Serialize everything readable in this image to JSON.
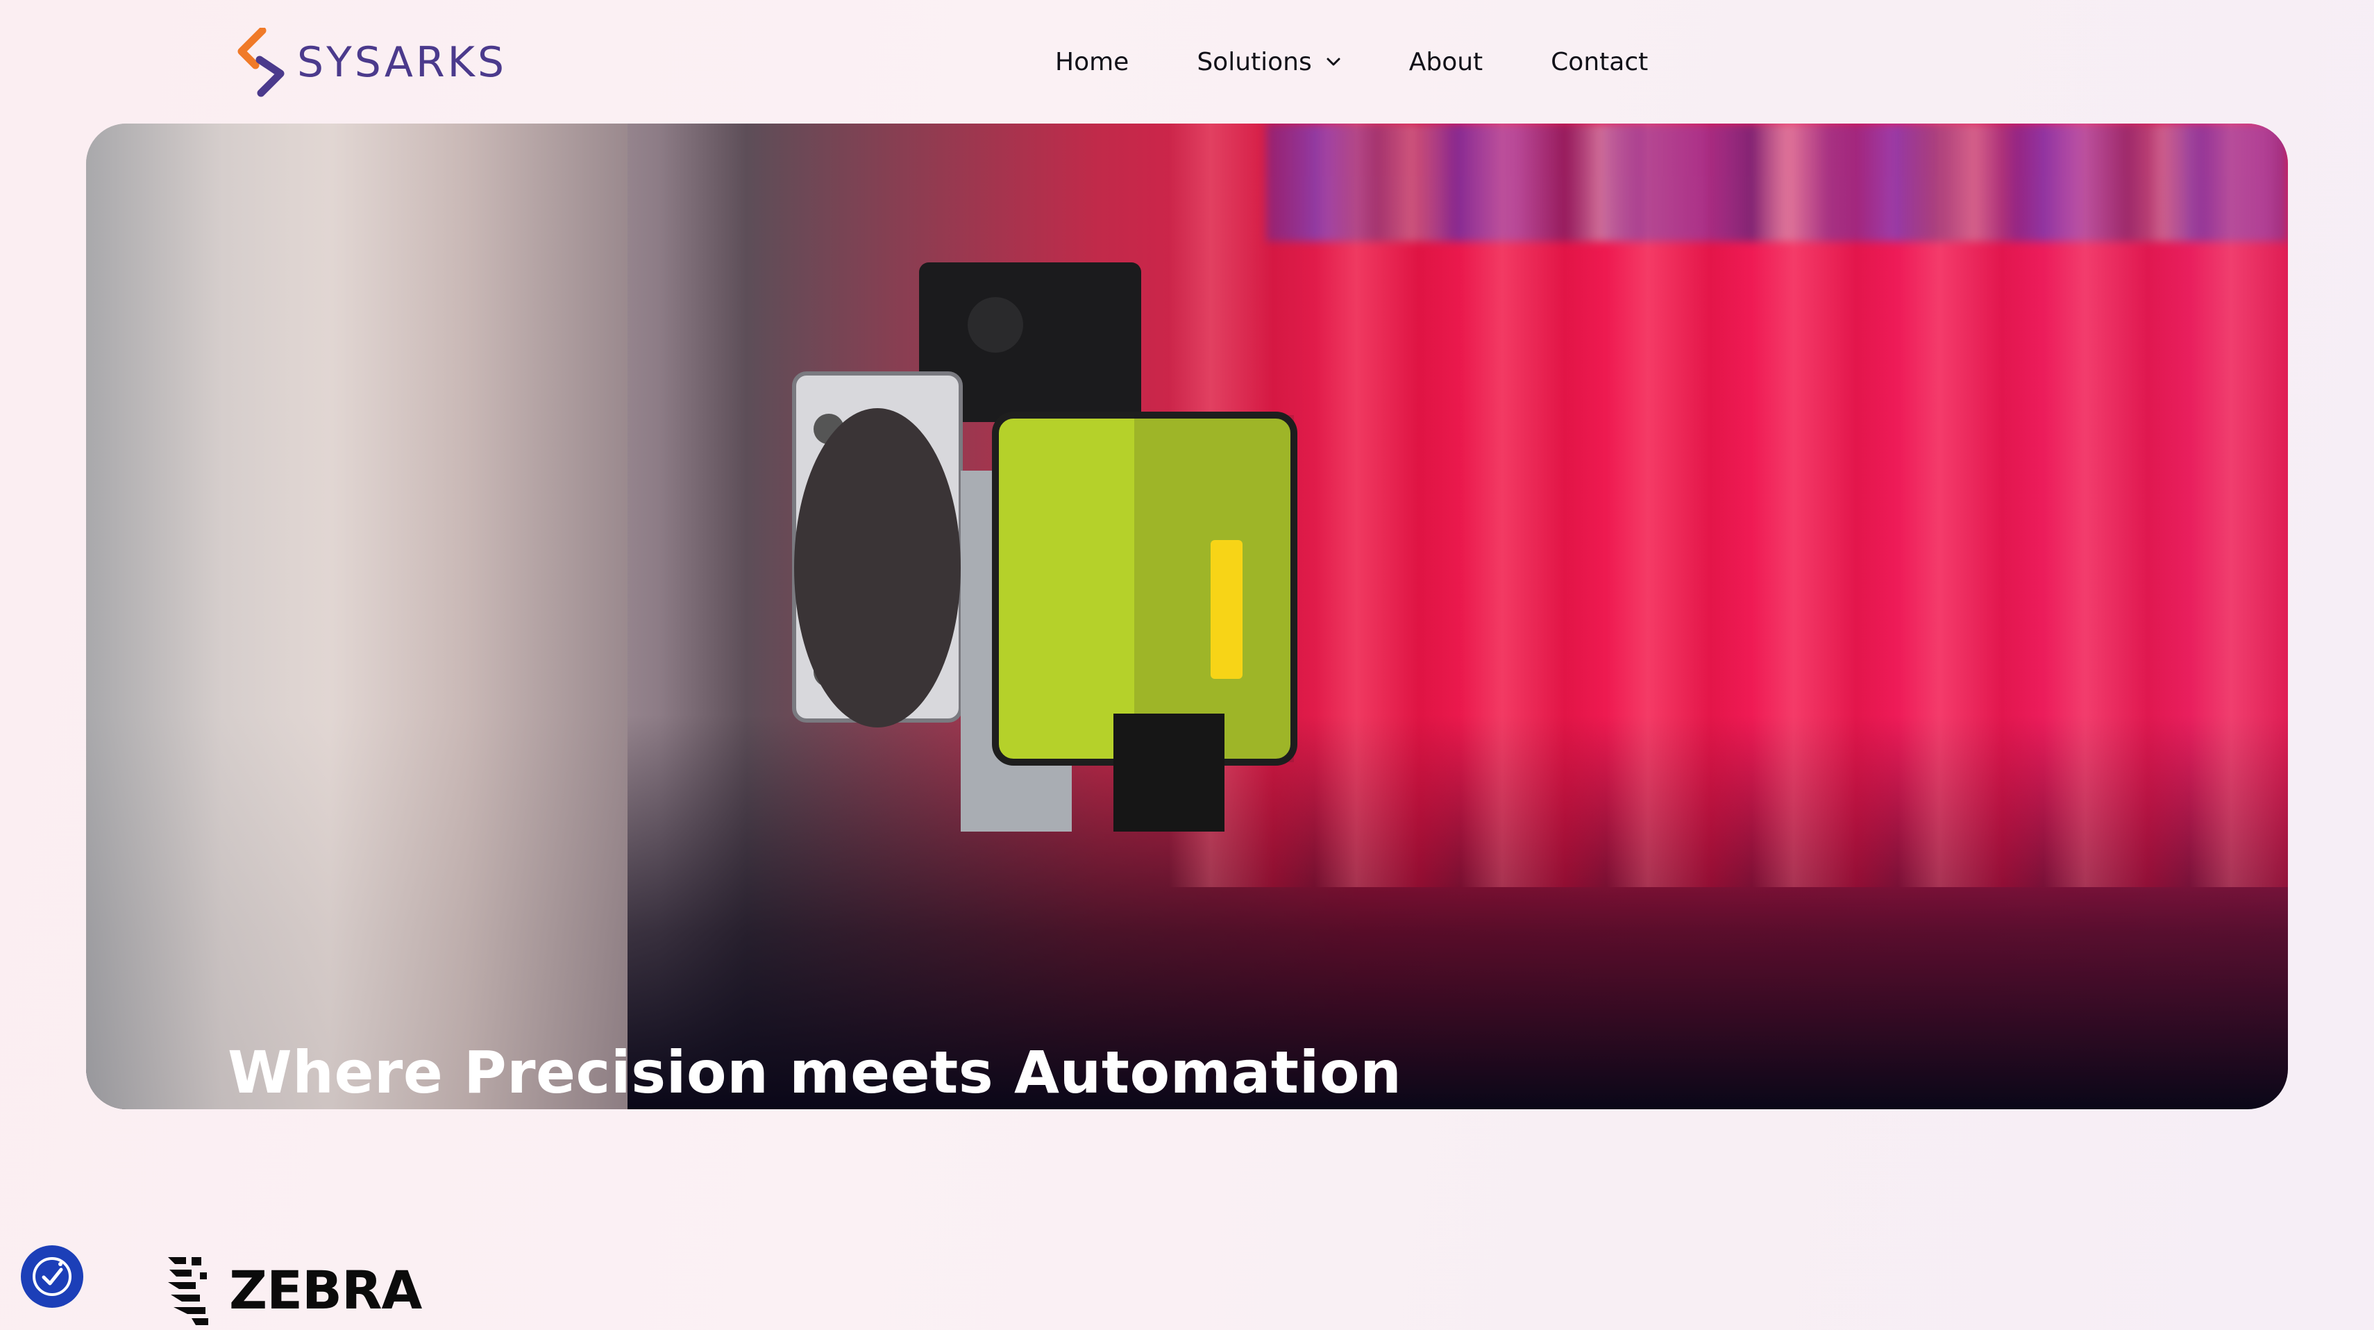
{
  "brand": {
    "name": "SYSARKS",
    "logo_icon": "sysarks-chevron-logo",
    "colors": {
      "orange": "#f07a28",
      "purple": "#4b3a8c"
    }
  },
  "nav": {
    "items": [
      {
        "label": "Home"
      },
      {
        "label": "Solutions",
        "icon": "chevron-down-icon"
      },
      {
        "label": "About"
      },
      {
        "label": "Contact"
      }
    ]
  },
  "hero": {
    "title": "Where Precision meets Automation"
  },
  "accessibility": {
    "icon": "accessibility-icon",
    "color": "#1c3fb8"
  },
  "partners": [
    {
      "name": "ZEBRA",
      "icon": "zebra-logo-icon"
    }
  ]
}
